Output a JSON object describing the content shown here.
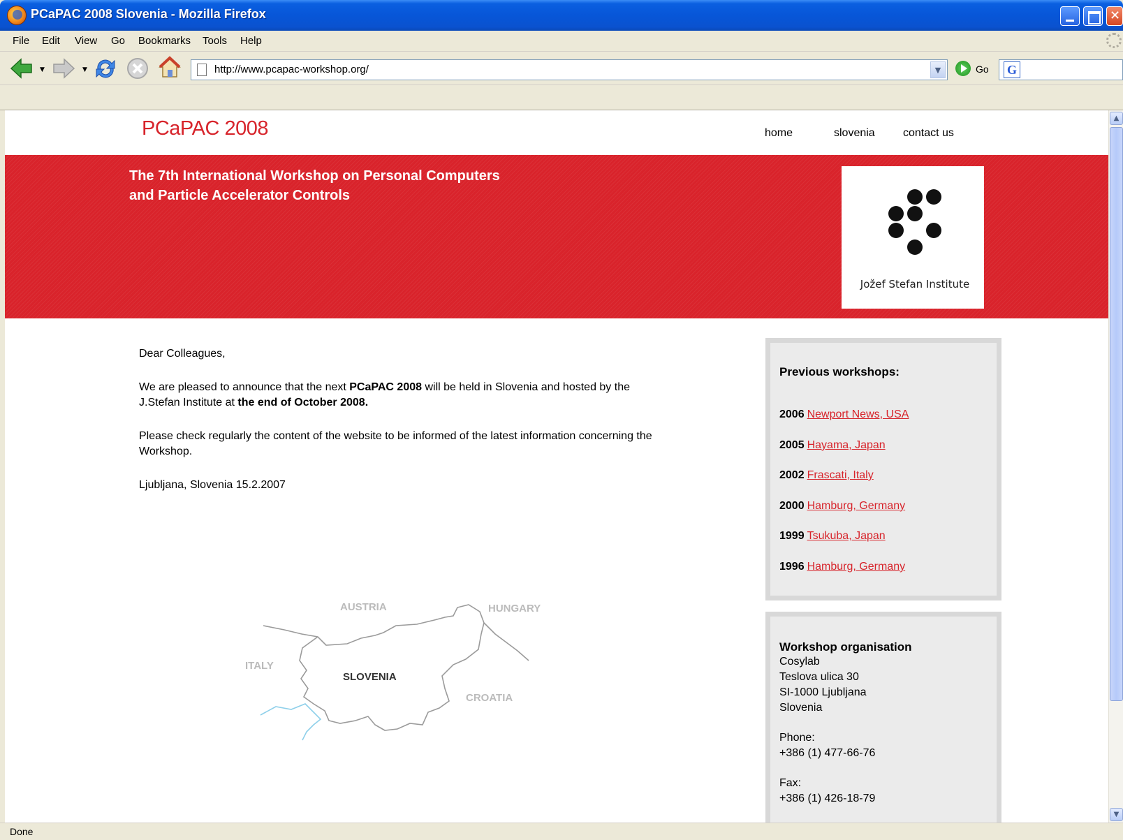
{
  "window": {
    "title": "PCaPAC 2008 Slovenia - Mozilla Firefox"
  },
  "menu": [
    "File",
    "Edit",
    "View",
    "Go",
    "Bookmarks",
    "Tools",
    "Help"
  ],
  "navbar": {
    "url": "http://www.pcapac-workshop.org/",
    "go_label": "Go",
    "search_placeholder": ""
  },
  "site": {
    "logo": "PCaPAC 2008",
    "nav": [
      "home",
      "slovenia",
      "contact us"
    ],
    "banner_title_line1": "The 7th International Workshop on Personal Computers",
    "banner_title_line2": "and Particle Accelerator Controls",
    "partner_label": "Jožef Stefan Institute",
    "greeting": "Dear Colleagues,",
    "announce_pre": "We are pleased to announce that the next ",
    "announce_event": "PCaPAC 2008",
    "announce_mid": " will be held in Slovenia and hosted by the J.Stefan Institute at ",
    "announce_date": "the end of October 2008.",
    "check_text": "Please check regularly the content of the website to be informed of the latest information concerning the Workshop.",
    "signature": "Ljubljana, Slovenia 15.2.2007",
    "map_labels": {
      "austria": "AUSTRIA",
      "hungary": "HUNGARY",
      "italy": "ITALY",
      "slovenia": "SLOVENIA",
      "croatia": "CROATIA"
    },
    "previous": {
      "heading": "Previous workshops:",
      "items": [
        {
          "year": "2006",
          "place": "Newport News, USA"
        },
        {
          "year": "2005",
          "place": "Hayama, Japan"
        },
        {
          "year": "2002",
          "place": "Frascati, Italy"
        },
        {
          "year": "2000",
          "place": "Hamburg, Germany"
        },
        {
          "year": "1999",
          "place": "Tsukuba, Japan"
        },
        {
          "year": "1996",
          "place": "Hamburg, Germany"
        }
      ]
    },
    "organisation": {
      "heading": "Workshop organisation",
      "name": "Cosylab",
      "street": "Teslova ulica 30",
      "city": "SI-1000 Ljubljana",
      "country": "Slovenia",
      "phone_label": "Phone:",
      "phone": "+386 (1) 477-66-76",
      "fax_label": "Fax:",
      "fax": "+386 (1) 426-18-79"
    }
  },
  "status": "Done",
  "colors": {
    "brand_red": "#d9232b",
    "link_red": "#d7242b",
    "panel_bg": "#ebebeb"
  }
}
